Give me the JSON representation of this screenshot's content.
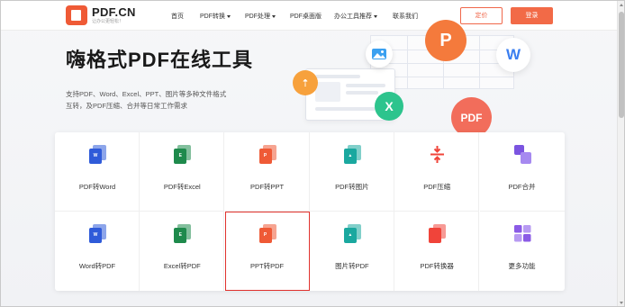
{
  "header": {
    "logo_name": "PDF.CN",
    "logo_slogan": "让办公更轻松！",
    "nav": [
      {
        "label": "首页",
        "dropdown": false
      },
      {
        "label": "PDF转换",
        "dropdown": true
      },
      {
        "label": "PDF处理",
        "dropdown": true
      },
      {
        "label": "PDF桌面版",
        "dropdown": false
      },
      {
        "label": "办公工具推荐",
        "dropdown": true
      },
      {
        "label": "联系我们",
        "dropdown": false
      }
    ],
    "vip_label": "定价",
    "login_label": "登录"
  },
  "hero": {
    "title": "嗨格式PDF在线工具",
    "desc_line1": "支持PDF、Word、Excel、PPT、图片等多种文件格式",
    "desc_line2": "互转，及PDF压缩、合并等日常工作需求"
  },
  "illustration": {
    "bubbles": [
      "P",
      "W",
      "X",
      "PDF"
    ]
  },
  "tools": [
    {
      "label": "PDF转Word",
      "icon": "word-doc-icon",
      "color": "#2f5bd9",
      "glyph": "W"
    },
    {
      "label": "PDF转Excel",
      "icon": "excel-doc-icon",
      "color": "#1e8a4c",
      "glyph": "E"
    },
    {
      "label": "PDF转PPT",
      "icon": "ppt-doc-icon",
      "color": "#ef5a36",
      "glyph": "P"
    },
    {
      "label": "PDF转图片",
      "icon": "image-doc-icon",
      "color": "#1aa89f",
      "glyph": "▲"
    },
    {
      "label": "PDF压缩",
      "icon": "compress-icon",
      "color": "#f0443a",
      "glyph": ""
    },
    {
      "label": "PDF合并",
      "icon": "merge-icon",
      "color": "#7b54e0",
      "glyph": ""
    },
    {
      "label": "Word转PDF",
      "icon": "word-doc-icon",
      "color": "#2f5bd9",
      "glyph": "W"
    },
    {
      "label": "Excel转PDF",
      "icon": "excel-doc-icon",
      "color": "#1e8a4c",
      "glyph": "E"
    },
    {
      "label": "PPT转PDF",
      "icon": "ppt-doc-icon",
      "color": "#ef5a36",
      "glyph": "P"
    },
    {
      "label": "图片转PDF",
      "icon": "image-doc-icon",
      "color": "#1aa89f",
      "glyph": "▲"
    },
    {
      "label": "PDF转换器",
      "icon": "converter-icon",
      "color": "#f0443a",
      "glyph": ""
    },
    {
      "label": "更多功能",
      "icon": "more-grid-icon",
      "color": "#8b5be6",
      "glyph": ""
    }
  ],
  "highlighted_tool": "PPT转PDF",
  "colors": {
    "accent": "#f26a47",
    "highlight_border": "#e0322d"
  }
}
